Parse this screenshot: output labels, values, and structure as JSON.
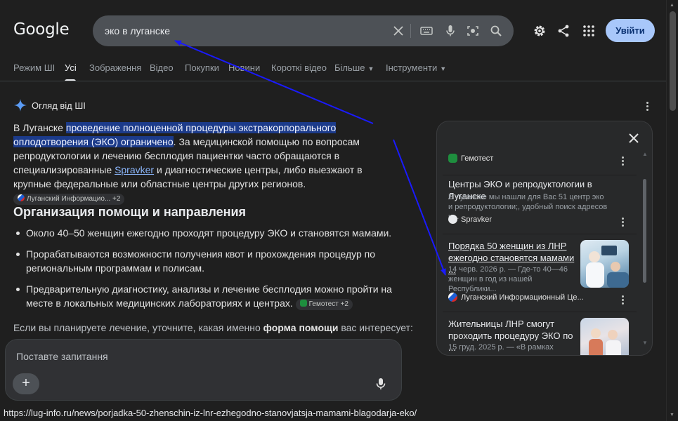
{
  "logo": "Google",
  "search": {
    "query": "эко в луганске"
  },
  "header": {
    "signin_label": "Увійти"
  },
  "tabs": [
    {
      "label": "Режим ШІ"
    },
    {
      "label": "Усі"
    },
    {
      "label": "Зображення"
    },
    {
      "label": "Відео"
    },
    {
      "label": "Покупки"
    },
    {
      "label": "Новини"
    },
    {
      "label": "Короткі відео"
    },
    {
      "label": "Більше"
    },
    {
      "label": "Інструменти"
    }
  ],
  "ai_overview": {
    "heading": "Огляд від ШІ",
    "p1_start": "В Луганске ",
    "p1_highlight": "проведение полноценной процедуры экстракорпорального оплодотворения (ЭКО) ограничено",
    "p1_mid": ". За медицинской помощью по вопросам репродуктологии и лечению бесплодия пациентки часто обращаются в специализированные ",
    "p1_link": "Spravker",
    "p1_end": " и диагностические центры, либо выезжают в крупные федеральные или областные центры других регионов.",
    "p1_chip": "Луганский Информацио... +2",
    "section_title": "Организация помощи и направления",
    "bullets": [
      "Около 40–50 женщин ежегодно проходят процедуру ЭКО и становятся мамами.",
      "Прорабатываются возможности получения квот и прохождения процедур по региональным программам и полисам.",
      "Предварительную диагностику, анализы и лечение бесплодия можно пройти на месте в локальных медицинских лабораториях и центрах."
    ],
    "bullet3_chip": "Гемотест +2",
    "tail_start": "Если вы планируете лечение, уточните, какая именно ",
    "tail_bold": "форма помощи",
    "tail_end": " вас интересует:"
  },
  "ask": {
    "placeholder": "Поставте запитання",
    "plus": "+"
  },
  "status_url": "https://lug-info.ru/news/porjadka-50-zhenschin-iz-lnr-ezhegodno-stanovjatsja-mamami-blagodarja-eko/",
  "sources": {
    "top_source": "Гемотест",
    "cards": [
      {
        "title": "Центры ЭКО и репродуктологии в Луганске",
        "snippet": "В луганске мы нашли для Вас 51 центр эко и репродуктологии;, удобный поиск адресов и...",
        "source": "Spravker"
      },
      {
        "title": "Порядка 50 женщин из ЛНР ежегодно становятся мамами ...",
        "snippet": "14 черв. 2026 р. — Где-то 40—46 женщин в год из нашей Республики...",
        "source": "Луганский Информационный Це..."
      },
      {
        "title": "Жительницы ЛНР смогут проходить процедуру ЭКО по ...",
        "snippet": "15 груд. 2025 р. — «В рамках"
      }
    ]
  },
  "colors": {
    "background": "#1f1f1f",
    "highlight": "#1c3b8a",
    "link": "#8ab4f8",
    "signin_button": "#a8c7fa",
    "annotation_arrow": "#1a1aff"
  }
}
